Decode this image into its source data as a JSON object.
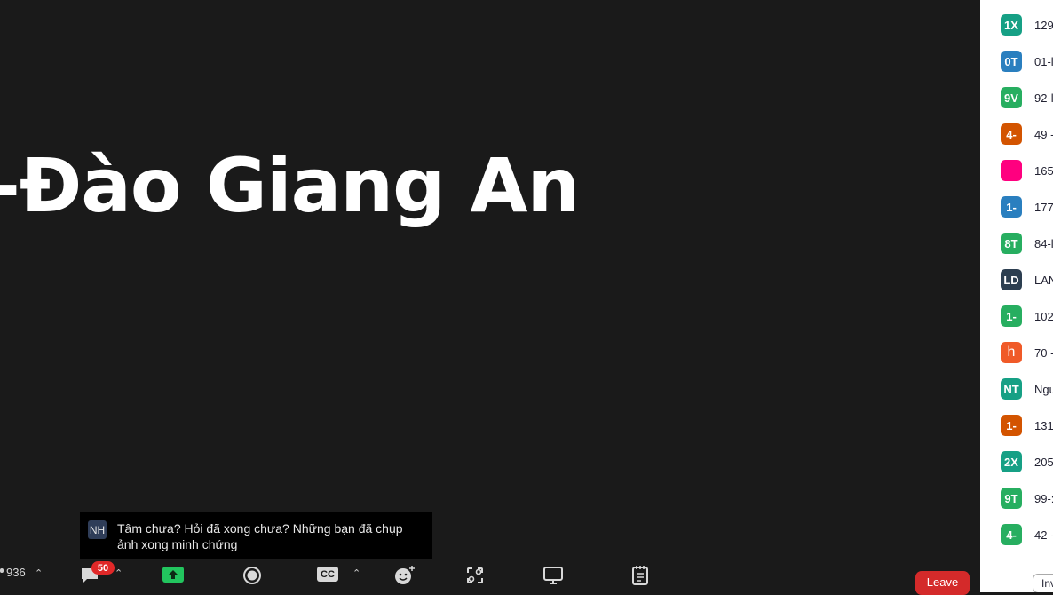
{
  "main": {
    "speaker_name": "-Đào Giang An"
  },
  "chat_toast": {
    "avatar_initials": "NH",
    "message": "Tâm chưa? Hỏi đã xong chưa? Những bạn đã chụp ảnh xong minh chứng"
  },
  "toolbar": {
    "participants_count": "936",
    "chat_badge": "50",
    "leave_label": "Leave",
    "icons": [
      "chat-icon",
      "share-screen-icon",
      "record-icon",
      "cc-icon",
      "reactions-icon",
      "apps-icon",
      "whiteboard-icon",
      "notes-icon"
    ],
    "share_color": "#22c55e",
    "cc_label": "CC"
  },
  "participants": [
    {
      "initials": "1X",
      "name": "129",
      "color": "#16a085"
    },
    {
      "initials": "0T",
      "name": "01-l",
      "color": "#2a7fbf"
    },
    {
      "initials": "9V",
      "name": "92-l",
      "color": "#27ae60"
    },
    {
      "initials": "4-",
      "name": "49 -",
      "color": "#d35400"
    },
    {
      "initials": "",
      "name": "165",
      "color": "#ff007f"
    },
    {
      "initials": "1-",
      "name": "177",
      "color": "#2a7fbf"
    },
    {
      "initials": "8T",
      "name": "84-l",
      "color": "#27ae60"
    },
    {
      "initials": "LD",
      "name": "LAN",
      "color": "#2c3e50"
    },
    {
      "initials": "1-",
      "name": "102",
      "color": "#27ae60"
    },
    {
      "initials": "h",
      "name": "70 -",
      "color": "#f05a28"
    },
    {
      "initials": "NT",
      "name": "Ngu",
      "color": "#16a085"
    },
    {
      "initials": "1-",
      "name": "131",
      "color": "#d35400"
    },
    {
      "initials": "2X",
      "name": "205",
      "color": "#16a085"
    },
    {
      "initials": "9T",
      "name": "99-:",
      "color": "#27ae60"
    },
    {
      "initials": "4-",
      "name": "42 -",
      "color": "#27ae60"
    }
  ],
  "panel": {
    "invite_label": "Inv"
  }
}
